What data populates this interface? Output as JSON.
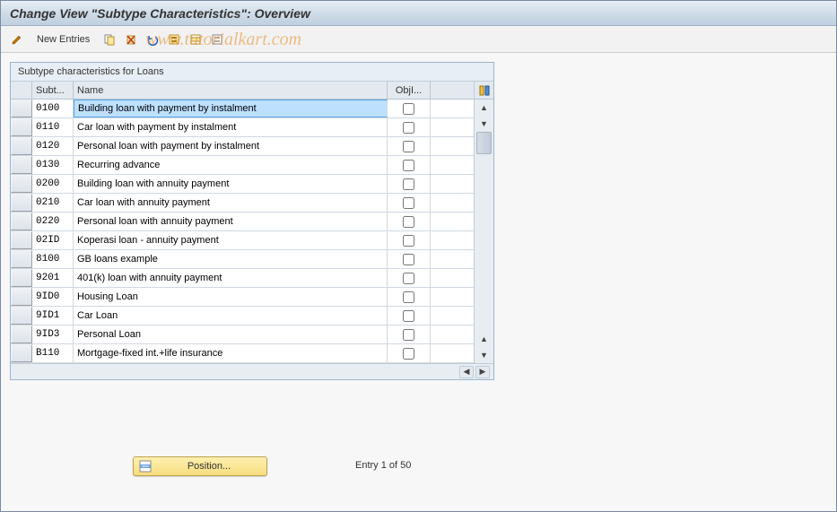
{
  "title": "Change View \"Subtype Characteristics\": Overview",
  "watermark": "www.tutorialkart.com",
  "toolbar": {
    "new_entries_label": "New Entries",
    "icons": {
      "edit": "pencil-icon",
      "copy": "copy-icon",
      "delete": "delete-icon",
      "undo": "undo-icon",
      "select_all": "select-all-icon",
      "deselect_all": "deselect-icon",
      "transport": "transport-icon"
    }
  },
  "table": {
    "panel_title": "Subtype characteristics for Loans",
    "columns": {
      "subtype": "Subt...",
      "name": "Name",
      "obj": "ObjI..."
    },
    "rows": [
      {
        "subtype": "0100",
        "name": "Building loan with payment by instalment",
        "obj": false,
        "selected": true
      },
      {
        "subtype": "0110",
        "name": "Car loan with payment by instalment",
        "obj": false
      },
      {
        "subtype": "0120",
        "name": "Personal loan with payment by instalment",
        "obj": false
      },
      {
        "subtype": "0130",
        "name": "Recurring advance",
        "obj": false
      },
      {
        "subtype": "0200",
        "name": "Building loan with annuity payment",
        "obj": false
      },
      {
        "subtype": "0210",
        "name": "Car loan with annuity payment",
        "obj": false
      },
      {
        "subtype": "0220",
        "name": "Personal loan with annuity payment",
        "obj": false
      },
      {
        "subtype": "02ID",
        "name": "Koperasi loan - annuity payment",
        "obj": false
      },
      {
        "subtype": "8100",
        "name": "GB loans example",
        "obj": false
      },
      {
        "subtype": "9201",
        "name": "401(k) loan with annuity payment",
        "obj": false
      },
      {
        "subtype": "9ID0",
        "name": "Housing Loan",
        "obj": false
      },
      {
        "subtype": "9ID1",
        "name": "Car Loan",
        "obj": false
      },
      {
        "subtype": "9ID3",
        "name": "Personal Loan",
        "obj": false
      },
      {
        "subtype": "B110",
        "name": "Mortgage-fixed int.+life insurance",
        "obj": false
      }
    ]
  },
  "footer": {
    "position_label": "Position...",
    "entry_text": "Entry 1 of 50"
  }
}
